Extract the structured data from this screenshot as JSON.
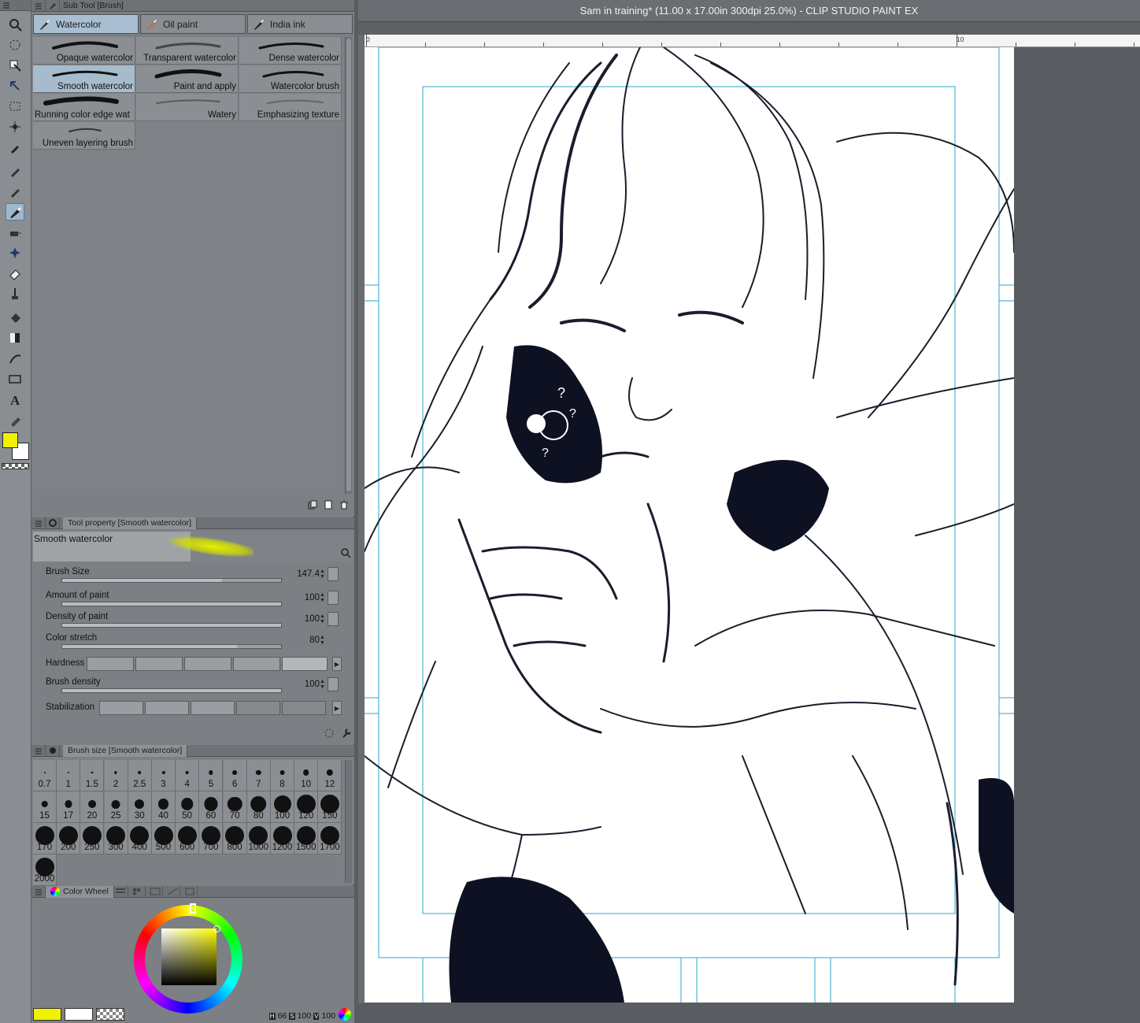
{
  "window": {
    "title": "Sam in training* (11.00 x 17.00in 300dpi 25.0%)  - CLIP STUDIO PAINT EX"
  },
  "colors": {
    "main": "#f2f200",
    "sub": "#ffffff",
    "accent": "#a9bfd1",
    "guide": "#2aa7cc"
  },
  "toolbar": {
    "tools": [
      {
        "name": "zoom-icon"
      },
      {
        "name": "move-icon"
      },
      {
        "name": "operation-icon"
      },
      {
        "name": "move-layer-icon"
      },
      {
        "name": "selection-icon"
      },
      {
        "name": "auto-select-icon"
      },
      {
        "name": "eyedropper-icon"
      },
      {
        "name": "pen-icon"
      },
      {
        "name": "pencil-icon"
      },
      {
        "name": "brush-icon"
      },
      {
        "name": "airbrush-icon"
      },
      {
        "name": "decoration-icon"
      },
      {
        "name": "eraser-icon"
      },
      {
        "name": "blend-icon"
      },
      {
        "name": "fill-icon"
      },
      {
        "name": "gradient-icon"
      },
      {
        "name": "figure-icon"
      },
      {
        "name": "frame-icon"
      },
      {
        "name": "text-icon"
      },
      {
        "name": "correct-line-icon"
      }
    ]
  },
  "subtool": {
    "title": "Sub Tool [Brush]",
    "groups": [
      "Watercolor",
      "Oil paint",
      "India ink"
    ],
    "brushes": [
      "Opaque watercolor",
      "Transparent watercolor",
      "Dense watercolor",
      "Smooth watercolor",
      "Paint and apply",
      "Watercolor brush",
      "Running color edge wat",
      "Watery",
      "Emphasizing texture",
      "Uneven layering brush"
    ]
  },
  "toolprop": {
    "title": "Tool property [Smooth watercolor]",
    "name": "Smooth watercolor",
    "brush_size": {
      "label": "Brush Size",
      "value": "147.4",
      "level": 0.73
    },
    "amount": {
      "label": "Amount of paint",
      "value": "100",
      "level": 1.0
    },
    "density": {
      "label": "Density of paint",
      "value": "100",
      "level": 1.0
    },
    "stretch": {
      "label": "Color stretch",
      "value": "80",
      "level": 0.8
    },
    "hardness": {
      "label": "Hardness"
    },
    "brush_density": {
      "label": "Brush density",
      "value": "100",
      "level": 1.0
    },
    "stabilization": {
      "label": "Stabilization"
    }
  },
  "brushsize": {
    "title": "Brush size [Smooth watercolor]",
    "sizes": [
      "0.7",
      "1",
      "1.5",
      "2",
      "2.5",
      "3",
      "4",
      "5",
      "6",
      "7",
      "8",
      "10",
      "12",
      "15",
      "17",
      "20",
      "25",
      "30",
      "40",
      "50",
      "60",
      "70",
      "80",
      "100",
      "120",
      "150",
      "170",
      "200",
      "250",
      "300",
      "400",
      "500",
      "600",
      "700",
      "800",
      "1000",
      "1200",
      "1500",
      "1700",
      "2000"
    ]
  },
  "colorwheel": {
    "title": "Color Wheel",
    "h_label": "H",
    "h": "66",
    "s_label": "S",
    "s": "100",
    "v_label": "V",
    "v": "100"
  },
  "ruler": {
    "label_0": "0",
    "label_10": "10"
  }
}
